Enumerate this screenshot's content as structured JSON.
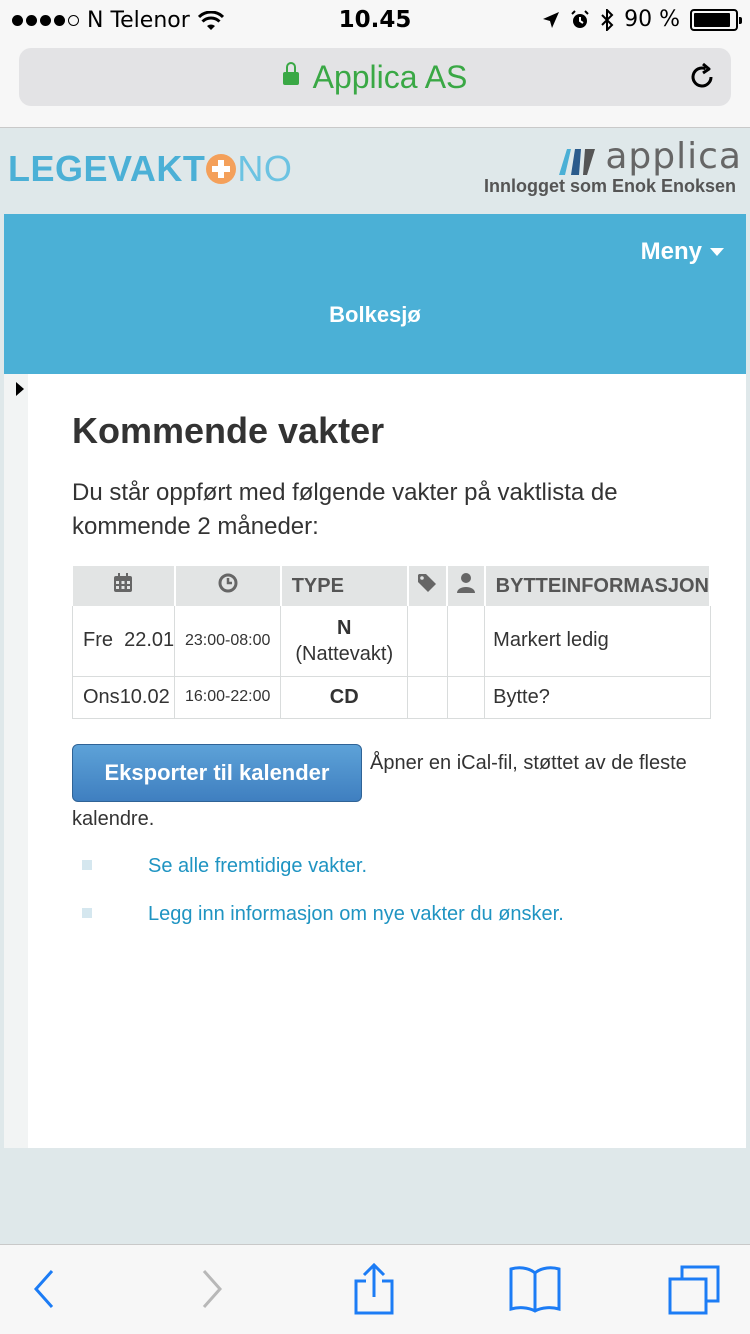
{
  "status_bar": {
    "carrier": "N Telenor",
    "time": "10.45",
    "battery_percent": "90 %",
    "battery_level": 0.9
  },
  "browser": {
    "url_title": "Applica AS"
  },
  "header": {
    "logo_main": "LEGEVAKT",
    "logo_suffix": "NO",
    "partner_logo": "applica",
    "logged_in_text": "Innlogget som Enok Enoksen"
  },
  "banner": {
    "menu_label": "Meny",
    "site_name": "Bolkesjø"
  },
  "main": {
    "title": "Kommende vakter",
    "intro": "Du står oppført med følgende vakter på vaktlista de kommende 2 måneder:",
    "table": {
      "headers": {
        "date_icon": "calendar-icon",
        "time_icon": "clock-icon",
        "type": "TYPE",
        "tag_icon": "tag-icon",
        "person_icon": "user-icon",
        "swap_info": "BYTTEINFORMASJON"
      },
      "rows": [
        {
          "weekday": "Fre",
          "date": "22.01",
          "time": "23:00-08:00",
          "type_code": "N",
          "type_name": "(Nattevakt)",
          "swap_link": "Markert ledig"
        },
        {
          "weekday": "Ons",
          "date": "10.02",
          "time": "16:00-22:00",
          "type_code": "CD",
          "type_name": "",
          "swap_link": "Bytte?"
        }
      ]
    },
    "export": {
      "button_label": "Eksporter til kalender",
      "description_line1": "Åpner en iCal-fil, støttet av de fleste",
      "description_line2": "kalendre."
    },
    "links": [
      "Se alle fremtidige vakter.",
      "Legg inn informasjon om nye vakter du ønsker."
    ]
  },
  "colors": {
    "brand_blue": "#4bb0d6",
    "link_blue": "#1f94c2",
    "button_blue": "#3f7fc0",
    "secure_green": "#3aa845",
    "accent_orange": "#f4a05a"
  }
}
